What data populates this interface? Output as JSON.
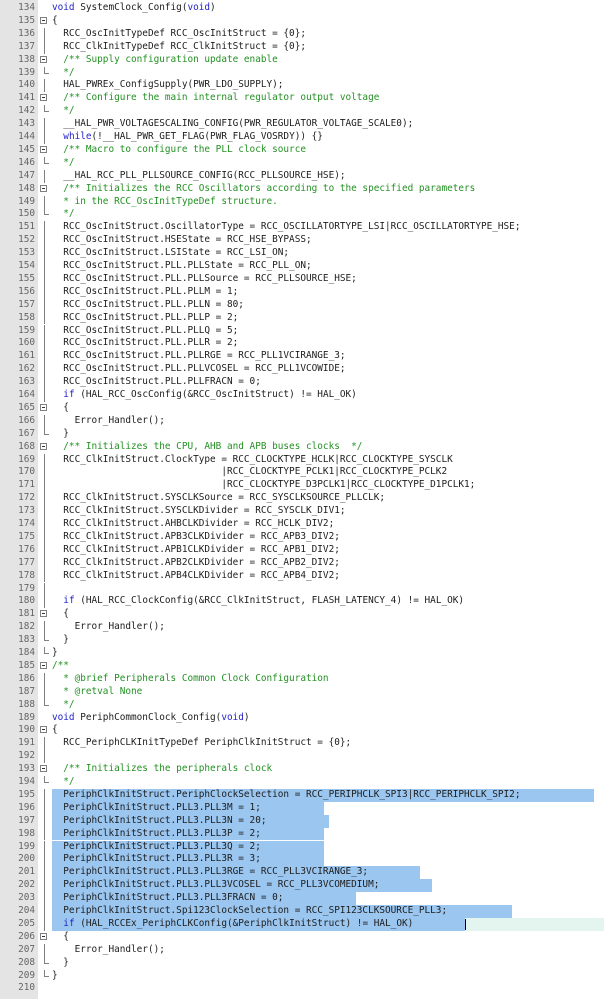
{
  "editor": {
    "lines": [
      {
        "n": "134",
        "segs": [
          {
            "t": "void",
            "c": "kw"
          },
          {
            "t": " SystemClock_Config("
          },
          {
            "t": "void",
            "c": "kw"
          },
          {
            "t": ")"
          }
        ]
      },
      {
        "n": "135",
        "fold": "box",
        "segs": [
          {
            "t": "{"
          }
        ]
      },
      {
        "n": "136",
        "fold": "v",
        "segs": [
          {
            "t": "  RCC_OscInitTypeDef RCC_OscInitStruct = {0};"
          }
        ]
      },
      {
        "n": "137",
        "fold": "v",
        "segs": [
          {
            "t": "  RCC_ClkInitTypeDef RCC_ClkInitStruct = {0};"
          }
        ]
      },
      {
        "n": "138",
        "fold": "box",
        "segs": [
          {
            "t": "  /** Supply configuration update enable",
            "c": "cm"
          }
        ]
      },
      {
        "n": "139",
        "fold": "end",
        "segs": [
          {
            "t": "  */",
            "c": "cm"
          }
        ]
      },
      {
        "n": "140",
        "fold": "v",
        "segs": [
          {
            "t": "  HAL_PWREx_ConfigSupply(PWR_LDO_SUPPLY);"
          }
        ]
      },
      {
        "n": "141",
        "fold": "box",
        "segs": [
          {
            "t": "  /** Configure the main internal regulator output voltage",
            "c": "cm"
          }
        ]
      },
      {
        "n": "142",
        "fold": "end",
        "segs": [
          {
            "t": "  */",
            "c": "cm"
          }
        ]
      },
      {
        "n": "143",
        "fold": "v",
        "segs": [
          {
            "t": "  __HAL_PWR_VOLTAGESCALING_CONFIG(PWR_REGULATOR_VOLTAGE_SCALE0);"
          }
        ]
      },
      {
        "n": "144",
        "fold": "v",
        "segs": [
          {
            "t": "  "
          },
          {
            "t": "while",
            "c": "kw"
          },
          {
            "t": "(!__HAL_PWR_GET_FLAG(PWR_FLAG_VOSRDY)) {}"
          }
        ]
      },
      {
        "n": "145",
        "fold": "box",
        "segs": [
          {
            "t": "  /** Macro to configure the PLL clock source",
            "c": "cm"
          }
        ]
      },
      {
        "n": "146",
        "fold": "end",
        "segs": [
          {
            "t": "  */",
            "c": "cm"
          }
        ]
      },
      {
        "n": "147",
        "fold": "v",
        "segs": [
          {
            "t": "  __HAL_RCC_PLL_PLLSOURCE_CONFIG(RCC_PLLSOURCE_HSE);"
          }
        ]
      },
      {
        "n": "148",
        "fold": "box",
        "segs": [
          {
            "t": "  /** Initializes the RCC Oscillators according to the specified parameters",
            "c": "cm"
          }
        ]
      },
      {
        "n": "149",
        "fold": "v",
        "segs": [
          {
            "t": "  * in the RCC_OscInitTypeDef structure.",
            "c": "cm"
          }
        ]
      },
      {
        "n": "150",
        "fold": "end",
        "segs": [
          {
            "t": "  */",
            "c": "cm"
          }
        ]
      },
      {
        "n": "151",
        "fold": "v",
        "segs": [
          {
            "t": "  RCC_OscInitStruct.OscillatorType = RCC_OSCILLATORTYPE_LSI|RCC_OSCILLATORTYPE_HSE;"
          }
        ]
      },
      {
        "n": "152",
        "fold": "v",
        "segs": [
          {
            "t": "  RCC_OscInitStruct.HSEState = RCC_HSE_BYPASS;"
          }
        ]
      },
      {
        "n": "153",
        "fold": "v",
        "segs": [
          {
            "t": "  RCC_OscInitStruct.LSIState = RCC_LSI_ON;"
          }
        ]
      },
      {
        "n": "154",
        "fold": "v",
        "segs": [
          {
            "t": "  RCC_OscInitStruct.PLL.PLLState = RCC_PLL_ON;"
          }
        ]
      },
      {
        "n": "155",
        "fold": "v",
        "segs": [
          {
            "t": "  RCC_OscInitStruct.PLL.PLLSource = RCC_PLLSOURCE_HSE;"
          }
        ]
      },
      {
        "n": "156",
        "fold": "v",
        "segs": [
          {
            "t": "  RCC_OscInitStruct.PLL.PLLM = 1;"
          }
        ]
      },
      {
        "n": "157",
        "fold": "v",
        "segs": [
          {
            "t": "  RCC_OscInitStruct.PLL.PLLN = 80;"
          }
        ]
      },
      {
        "n": "158",
        "fold": "v",
        "segs": [
          {
            "t": "  RCC_OscInitStruct.PLL.PLLP = 2;"
          }
        ]
      },
      {
        "n": "159",
        "fold": "v",
        "segs": [
          {
            "t": "  RCC_OscInitStruct.PLL.PLLQ = 5;"
          }
        ]
      },
      {
        "n": "160",
        "fold": "v",
        "segs": [
          {
            "t": "  RCC_OscInitStruct.PLL.PLLR = 2;"
          }
        ]
      },
      {
        "n": "161",
        "fold": "v",
        "segs": [
          {
            "t": "  RCC_OscInitStruct.PLL.PLLRGE = RCC_PLL1VCIRANGE_3;"
          }
        ]
      },
      {
        "n": "162",
        "fold": "v",
        "segs": [
          {
            "t": "  RCC_OscInitStruct.PLL.PLLVCOSEL = RCC_PLL1VCOWIDE;"
          }
        ]
      },
      {
        "n": "163",
        "fold": "v",
        "segs": [
          {
            "t": "  RCC_OscInitStruct.PLL.PLLFRACN = 0;"
          }
        ]
      },
      {
        "n": "164",
        "fold": "v",
        "segs": [
          {
            "t": "  "
          },
          {
            "t": "if",
            "c": "kw"
          },
          {
            "t": " (HAL_RCC_OscConfig(&RCC_OscInitStruct) != HAL_OK)"
          }
        ]
      },
      {
        "n": "165",
        "fold": "box",
        "segs": [
          {
            "t": "  {"
          }
        ]
      },
      {
        "n": "166",
        "fold": "v",
        "segs": [
          {
            "t": "    Error_Handler();"
          }
        ]
      },
      {
        "n": "167",
        "fold": "end",
        "segs": [
          {
            "t": "  }"
          }
        ]
      },
      {
        "n": "168",
        "fold": "box",
        "segs": [
          {
            "t": "  /** Initializes the CPU, AHB and APB buses clocks  */",
            "c": "cm"
          }
        ]
      },
      {
        "n": "169",
        "fold": "v",
        "segs": [
          {
            "t": "  RCC_ClkInitStruct.ClockType = RCC_CLOCKTYPE_HCLK|RCC_CLOCKTYPE_SYSCLK"
          }
        ]
      },
      {
        "n": "170",
        "fold": "v",
        "segs": [
          {
            "t": "                              |RCC_CLOCKTYPE_PCLK1|RCC_CLOCKTYPE_PCLK2"
          }
        ]
      },
      {
        "n": "171",
        "fold": "v",
        "segs": [
          {
            "t": "                              |RCC_CLOCKTYPE_D3PCLK1|RCC_CLOCKTYPE_D1PCLK1;"
          }
        ]
      },
      {
        "n": "172",
        "fold": "v",
        "segs": [
          {
            "t": "  RCC_ClkInitStruct.SYSCLKSource = RCC_SYSCLKSOURCE_PLLCLK;"
          }
        ]
      },
      {
        "n": "173",
        "fold": "v",
        "segs": [
          {
            "t": "  RCC_ClkInitStruct.SYSCLKDivider = RCC_SYSCLK_DIV1;"
          }
        ]
      },
      {
        "n": "174",
        "fold": "v",
        "segs": [
          {
            "t": "  RCC_ClkInitStruct.AHBCLKDivider = RCC_HCLK_DIV2;"
          }
        ]
      },
      {
        "n": "175",
        "fold": "v",
        "segs": [
          {
            "t": "  RCC_ClkInitStruct.APB3CLKDivider = RCC_APB3_DIV2;"
          }
        ]
      },
      {
        "n": "176",
        "fold": "v",
        "segs": [
          {
            "t": "  RCC_ClkInitStruct.APB1CLKDivider = RCC_APB1_DIV2;"
          }
        ]
      },
      {
        "n": "177",
        "fold": "v",
        "segs": [
          {
            "t": "  RCC_ClkInitStruct.APB2CLKDivider = RCC_APB2_DIV2;"
          }
        ]
      },
      {
        "n": "178",
        "fold": "v",
        "segs": [
          {
            "t": "  RCC_ClkInitStruct.APB4CLKDivider = RCC_APB4_DIV2;"
          }
        ]
      },
      {
        "n": "179",
        "fold": "v",
        "segs": [
          {
            "t": ""
          }
        ]
      },
      {
        "n": "180",
        "fold": "v",
        "segs": [
          {
            "t": "  "
          },
          {
            "t": "if",
            "c": "kw"
          },
          {
            "t": " (HAL_RCC_ClockConfig(&RCC_ClkInitStruct, FLASH_LATENCY_4) != HAL_OK)"
          }
        ]
      },
      {
        "n": "181",
        "fold": "box",
        "segs": [
          {
            "t": "  {"
          }
        ]
      },
      {
        "n": "182",
        "fold": "v",
        "segs": [
          {
            "t": "    Error_Handler();"
          }
        ]
      },
      {
        "n": "183",
        "fold": "end",
        "segs": [
          {
            "t": "  }"
          }
        ]
      },
      {
        "n": "184",
        "fold": "end",
        "segs": [
          {
            "t": "}"
          }
        ]
      },
      {
        "n": "185",
        "fold": "box",
        "segs": [
          {
            "t": "/**",
            "c": "cm"
          }
        ]
      },
      {
        "n": "186",
        "fold": "v",
        "segs": [
          {
            "t": "  * @brief Peripherals Common Clock Configuration",
            "c": "cm"
          }
        ]
      },
      {
        "n": "187",
        "fold": "v",
        "segs": [
          {
            "t": "  * @retval None",
            "c": "cm"
          }
        ]
      },
      {
        "n": "188",
        "fold": "end",
        "segs": [
          {
            "t": "  */",
            "c": "cm"
          }
        ]
      },
      {
        "n": "189",
        "segs": [
          {
            "t": "void",
            "c": "kw"
          },
          {
            "t": " PeriphCommonClock_Config("
          },
          {
            "t": "void",
            "c": "kw"
          },
          {
            "t": ")"
          }
        ]
      },
      {
        "n": "190",
        "fold": "box",
        "segs": [
          {
            "t": "{"
          }
        ]
      },
      {
        "n": "191",
        "fold": "v",
        "segs": [
          {
            "t": "  RCC_PeriphCLKInitTypeDef PeriphClkInitStruct = {0};"
          }
        ]
      },
      {
        "n": "192",
        "fold": "v",
        "segs": [
          {
            "t": ""
          }
        ]
      },
      {
        "n": "193",
        "fold": "box",
        "segs": [
          {
            "t": "  /** Initializes the peripherals clock",
            "c": "cm"
          }
        ]
      },
      {
        "n": "194",
        "fold": "end",
        "segs": [
          {
            "t": "  */",
            "c": "cm"
          }
        ]
      },
      {
        "n": "195",
        "fold": "v",
        "sel": [
          52,
          594
        ],
        "segs": [
          {
            "t": "  PeriphClkInitStruct.PeriphClockSelection = RCC_PERIPHCLK_SPI3|RCC_PERIPHCLK_SPI2;"
          }
        ]
      },
      {
        "n": "196",
        "fold": "v",
        "sel": [
          52,
          324
        ],
        "segs": [
          {
            "t": "  PeriphClkInitStruct.PLL3.PLL3M = 1;"
          }
        ]
      },
      {
        "n": "197",
        "fold": "v",
        "sel": [
          52,
          329
        ],
        "segs": [
          {
            "t": "  PeriphClkInitStruct.PLL3.PLL3N = 20;"
          }
        ]
      },
      {
        "n": "198",
        "fold": "v",
        "sel": [
          52,
          324
        ],
        "segs": [
          {
            "t": "  PeriphClkInitStruct.PLL3.PLL3P = 2;"
          }
        ]
      },
      {
        "n": "199",
        "fold": "v",
        "sel": [
          52,
          324
        ],
        "segs": [
          {
            "t": "  PeriphClkInitStruct.PLL3.PLL3Q = 2;"
          }
        ]
      },
      {
        "n": "200",
        "fold": "v",
        "sel": [
          52,
          324
        ],
        "segs": [
          {
            "t": "  PeriphClkInitStruct.PLL3.PLL3R = 3;"
          }
        ]
      },
      {
        "n": "201",
        "fold": "v",
        "sel": [
          52,
          420
        ],
        "segs": [
          {
            "t": "  PeriphClkInitStruct.PLL3.PLL3RGE = RCC_PLL3VCIRANGE_3;"
          }
        ]
      },
      {
        "n": "202",
        "fold": "v",
        "sel": [
          52,
          432
        ],
        "segs": [
          {
            "t": "  PeriphClkInitStruct.PLL3.PLL3VCOSEL = RCC_PLL3VCOMEDIUM;"
          }
        ]
      },
      {
        "n": "203",
        "fold": "v",
        "sel": [
          52,
          356
        ],
        "segs": [
          {
            "t": "  PeriphClkInitStruct.PLL3.PLL3FRACN = 0;"
          }
        ]
      },
      {
        "n": "204",
        "fold": "v",
        "sel": [
          52,
          512
        ],
        "segs": [
          {
            "t": "  PeriphClkInitStruct.Spi123ClockSelection = RCC_SPI123CLKSOURCE_PLL3;"
          }
        ]
      },
      {
        "n": "205",
        "fold": "v",
        "sel": [
          52,
          465
        ],
        "cur": true,
        "caret": 465,
        "segs": [
          {
            "t": "  "
          },
          {
            "t": "if",
            "c": "kw"
          },
          {
            "t": " (HAL_RCCEx_PeriphCLKConfig(&PeriphClkInitStruct) != HAL_OK)"
          }
        ]
      },
      {
        "n": "206",
        "fold": "box",
        "segs": [
          {
            "t": "  {"
          }
        ]
      },
      {
        "n": "207",
        "fold": "v",
        "segs": [
          {
            "t": "    Error_Handler();"
          }
        ]
      },
      {
        "n": "208",
        "fold": "end",
        "segs": [
          {
            "t": "  }"
          }
        ]
      },
      {
        "n": "209",
        "fold": "end",
        "segs": [
          {
            "t": "}"
          }
        ]
      },
      {
        "n": "210",
        "segs": [
          {
            "t": ""
          }
        ]
      }
    ]
  }
}
